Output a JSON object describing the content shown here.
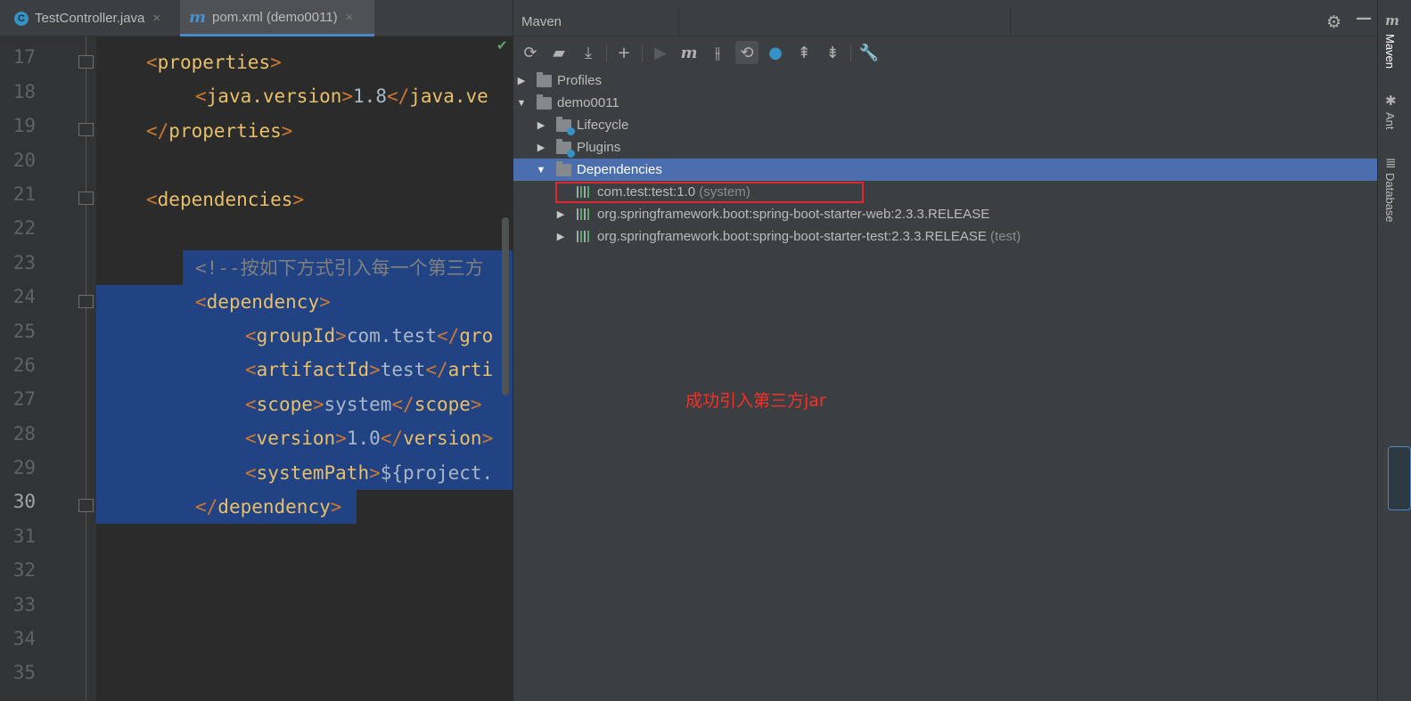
{
  "tabs": [
    {
      "icon": "C",
      "label": "TestController.java",
      "close": "×"
    },
    {
      "icon": "m",
      "label": "pom.xml (demo0011)",
      "close": "×"
    }
  ],
  "editor": {
    "line_numbers": [
      "17",
      "18",
      "19",
      "20",
      "21",
      "22",
      "23",
      "24",
      "25",
      "26",
      "27",
      "28",
      "29",
      "30",
      "31",
      "32",
      "33",
      "34",
      "35"
    ],
    "current_line": "30",
    "lines": {
      "l17": {
        "open": "<",
        "tag": "properties",
        "close": ">"
      },
      "l18": {
        "open": "<",
        "tag": "java.version",
        "mid": ">",
        "text": "1.8",
        "endopen": "</",
        "endtag": "java.ve"
      },
      "l19": {
        "open": "</",
        "tag": "properties",
        "close": ">"
      },
      "l21": {
        "open": "<",
        "tag": "dependencies",
        "close": ">"
      },
      "l23": {
        "comment": "<!--按如下方式引入每一个第三方"
      },
      "l24": {
        "open": "<",
        "tag": "dependency",
        "close": ">"
      },
      "l25": {
        "open": "<",
        "tag": "groupId",
        "mid": ">",
        "text": "com.test",
        "endopen": "</",
        "endtag": "gro"
      },
      "l26": {
        "open": "<",
        "tag": "artifactId",
        "mid": ">",
        "text": "test",
        "endopen": "</",
        "endtag": "arti"
      },
      "l27": {
        "open": "<",
        "tag": "scope",
        "mid": ">",
        "text": "system",
        "endopen": "</",
        "endtag": "scope",
        "endclose": ">"
      },
      "l28": {
        "open": "<",
        "tag": "version",
        "mid": ">",
        "text": "1.0",
        "endopen": "</",
        "endtag": "version",
        "endclose": ">"
      },
      "l29": {
        "open": "<",
        "tag": "systemPath",
        "mid": ">",
        "text": "${project."
      },
      "l30": {
        "open": "</",
        "tag": "dependency",
        "close": ">"
      }
    }
  },
  "maven": {
    "title": "Maven",
    "tree": {
      "profiles": "Profiles",
      "project": "demo0011",
      "lifecycle": "Lifecycle",
      "plugins": "Plugins",
      "dependencies": "Dependencies",
      "deps": [
        {
          "name": "com.test:test:1.0",
          "scope": "(system)"
        },
        {
          "name": "org.springframework.boot:spring-boot-starter-web:2.3.3.RELEASE",
          "scope": ""
        },
        {
          "name": "org.springframework.boot:spring-boot-starter-test:2.3.3.RELEASE",
          "scope": "(test)"
        }
      ]
    }
  },
  "annotation": "成功引入第三方jar",
  "right_strip": {
    "maven": "Maven",
    "ant": "Ant",
    "database": "Database"
  },
  "colors": {
    "selection": "#214283",
    "tree_selection": "#4b6eaf",
    "annotation": "#f0312c",
    "tag": "#e8bf6a"
  }
}
